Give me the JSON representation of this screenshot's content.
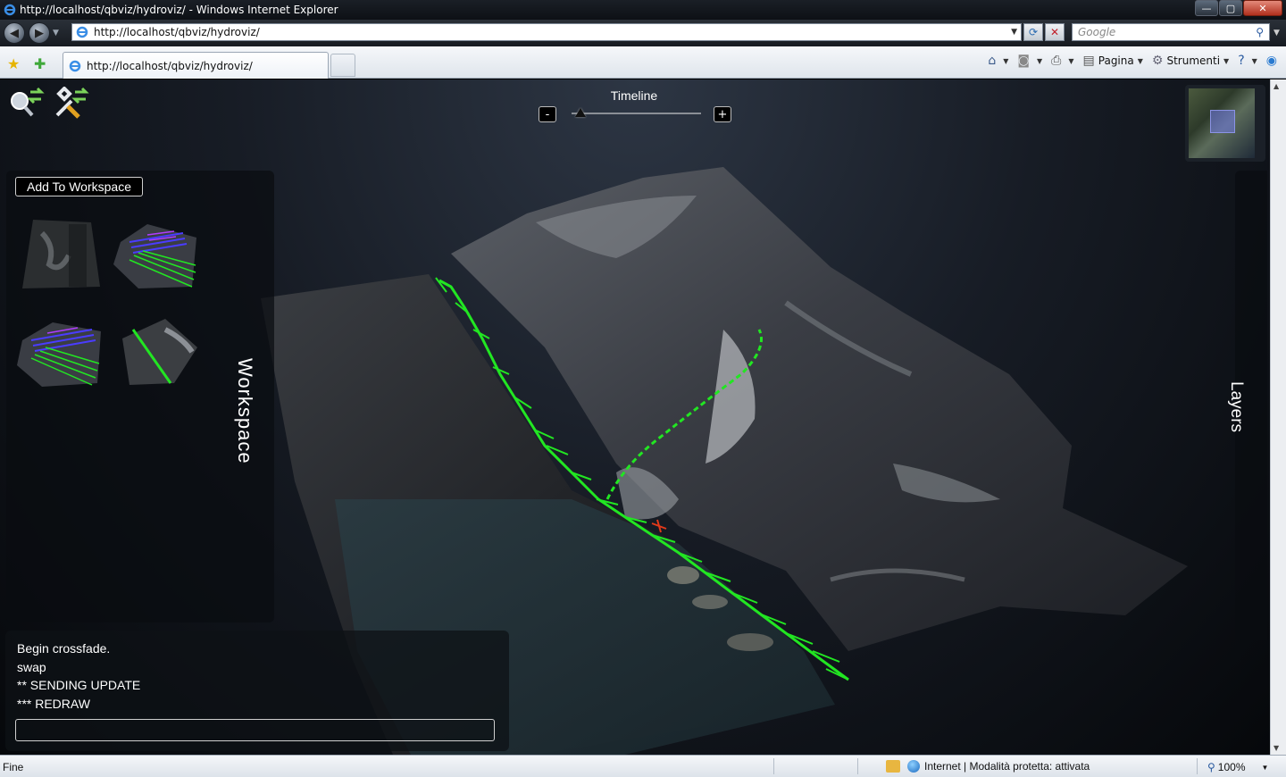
{
  "window": {
    "title": "http://localhost/qbviz/hydroviz/ - Windows Internet Explorer",
    "controls": {
      "minimize": "—",
      "maximize": "▢",
      "close": "✕"
    }
  },
  "addressbar": {
    "url": "http://localhost/qbviz/hydroviz/",
    "search_placeholder": "Google"
  },
  "tabs": [
    {
      "label": "http://localhost/qbviz/hydroviz/"
    }
  ],
  "commandbar": {
    "page_label": "Pagina",
    "tools_label": "Strumenti"
  },
  "app": {
    "timeline": {
      "label": "Timeline",
      "minus_label": "-",
      "plus_label": "+",
      "position": 0.07
    },
    "workspace": {
      "add_button_label": "Add To Workspace",
      "panel_label": "Workspace",
      "thumbnails": [
        {
          "name": "terrain-photo"
        },
        {
          "name": "flow-vectors-blue"
        },
        {
          "name": "flow-vectors-overview"
        },
        {
          "name": "terrain-with-path"
        }
      ]
    },
    "layers": {
      "panel_label": "Layers"
    },
    "console": {
      "lines": [
        "Begin crossfade.",
        "swap",
        "** SENDING UPDATE",
        "*** REDRAW"
      ],
      "input_value": ""
    }
  },
  "statusbar": {
    "status": "Fine",
    "zone": "Internet | Modalità protetta: attivata",
    "zoom": "100%"
  },
  "colors": {
    "flow_vectors": "#22e622",
    "marker": "#e23a1a",
    "background": "#171c25"
  }
}
